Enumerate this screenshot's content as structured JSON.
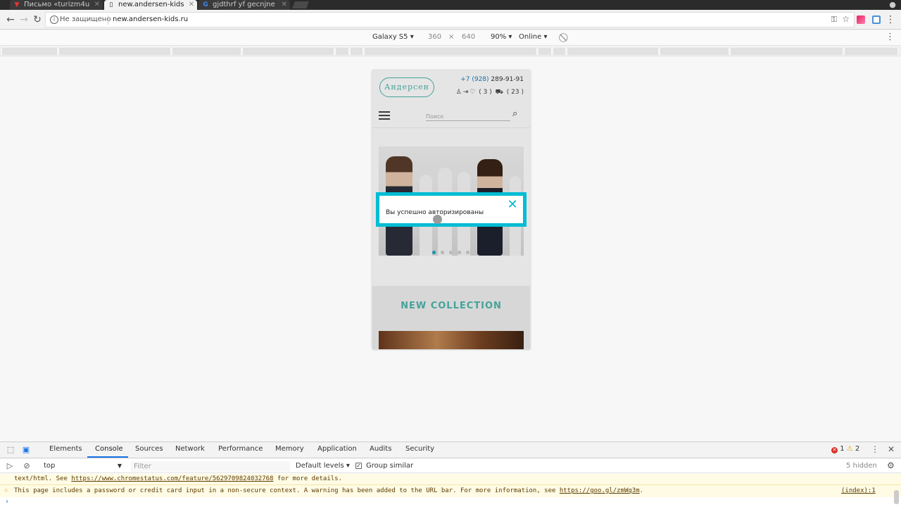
{
  "tabs": [
    {
      "title": "Письмо «turizm4u",
      "icon": "gmail-icon"
    },
    {
      "title": "new.andersen-kids",
      "icon": "page-icon"
    },
    {
      "title": "gjdthrf yf gecnjne",
      "icon": "google-icon"
    }
  ],
  "address_bar": {
    "security_text": "Не защищено",
    "url": "new.andersen-kids.ru"
  },
  "device_toolbar": {
    "device": "Galaxy S5",
    "width": "360",
    "times": "×",
    "height": "640",
    "zoom": "90%",
    "network": "Online"
  },
  "site": {
    "logo_text": "Андерсен",
    "phone_code": "+7 (928)",
    "phone_number": "289-91-91",
    "wishlist_count": "( 3 )",
    "cart_count": "( 23 )",
    "search_placeholder": "Поиск",
    "collection_title": "NEW COLLECTION",
    "slider_dots": 5,
    "active_slide": 1
  },
  "modal": {
    "message": "Вы успешно авторизированы"
  },
  "devtools": {
    "tabs": [
      "Elements",
      "Console",
      "Sources",
      "Network",
      "Performance",
      "Memory",
      "Application",
      "Audits",
      "Security"
    ],
    "active_tab": "Console",
    "error_count": "1",
    "warning_count": "2",
    "context": "top",
    "filter_placeholder": "Filter",
    "levels": "Default levels",
    "group_similar": "Group similar",
    "hidden": "5 hidden",
    "messages": [
      {
        "prefix": "text/html. See ",
        "link": "https://www.chromestatus.com/feature/5629709824032768",
        "suffix": " for more details."
      },
      {
        "prefix": "This page includes a password or credit card input in a non-secure context. A warning has been added to the URL bar. For more information, see ",
        "link": "https://goo.gl/zmWq3m",
        "suffix": ".",
        "source": "(index):1"
      }
    ]
  },
  "colors": {
    "accent": "#00bcd4",
    "brand_teal": "#4db6ac",
    "devtools_blue": "#1a73e8"
  }
}
